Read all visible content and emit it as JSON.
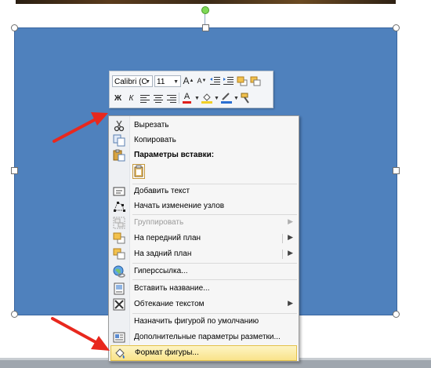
{
  "colors": {
    "shape_fill": "#4f81bd",
    "arrow": "#e8281e",
    "highlight": "#f9e38a"
  },
  "mini_toolbar": {
    "font_name": "Calibri (С",
    "font_size": "11",
    "grow_font_label": "A",
    "shrink_font_label": "A",
    "bold_label": "Ж",
    "italic_label": "К",
    "font_color_label": "A",
    "icons": [
      "grow-font-icon",
      "shrink-font-icon",
      "decrease-indent-icon",
      "increase-indent-icon",
      "bring-forward-icon",
      "send-backward-icon",
      "align-left-icon",
      "align-center-icon",
      "align-right-icon",
      "fill-color-icon",
      "outline-color-icon",
      "format-painter-icon"
    ]
  },
  "context_menu": {
    "items": [
      {
        "label": "Вырезать",
        "icon": "scissors-icon"
      },
      {
        "label": "Копировать",
        "icon": "copy-icon"
      },
      {
        "label": "Параметры вставки:",
        "icon": "paste-icon"
      },
      {
        "label": "Добавить текст",
        "icon": "text-box-icon"
      },
      {
        "label": "Начать изменение узлов",
        "icon": "edit-points-icon"
      },
      {
        "label": "Группировать",
        "icon": "group-icon",
        "disabled": true
      },
      {
        "label": "На передний план",
        "icon": "bring-front-icon"
      },
      {
        "label": "На задний план",
        "icon": "send-back-icon"
      },
      {
        "label": "Гиперссылка...",
        "icon": "hyperlink-icon"
      },
      {
        "label": "Вставить название...",
        "icon": "caption-icon"
      },
      {
        "label": "Обтекание текстом",
        "icon": "text-wrap-icon"
      },
      {
        "label": "Назначить фигурой по умолчанию",
        "icon": ""
      },
      {
        "label": "Дополнительные параметры разметки...",
        "icon": "layout-icon"
      },
      {
        "label": "Формат фигуры...",
        "icon": "format-shape-icon",
        "highlighted": true
      }
    ]
  }
}
